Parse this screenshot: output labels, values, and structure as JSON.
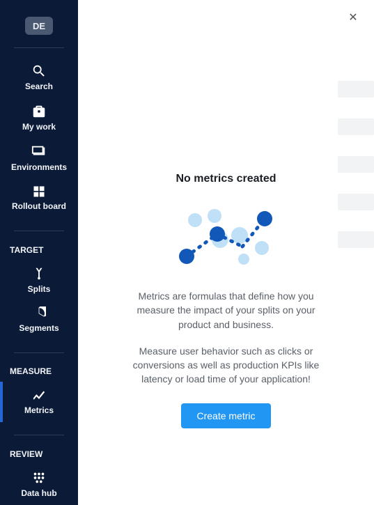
{
  "avatar": {
    "initials": "DE"
  },
  "sidebar": {
    "items": [
      {
        "label": "Search"
      },
      {
        "label": "My work"
      },
      {
        "label": "Environments"
      },
      {
        "label": "Rollout board"
      }
    ],
    "sections": {
      "target": {
        "title": "TARGET",
        "items": [
          {
            "label": "Splits"
          },
          {
            "label": "Segments"
          }
        ]
      },
      "measure": {
        "title": "MEASURE",
        "items": [
          {
            "label": "Metrics"
          }
        ]
      },
      "review": {
        "title": "REVIEW",
        "items": [
          {
            "label": "Data hub"
          }
        ]
      }
    }
  },
  "empty": {
    "title": "No metrics created",
    "p1": "Metrics are formulas that define how you measure the impact of your splits on your product and business.",
    "p2": "Measure user behavior such as clicks or conversions as well as production KPIs like latency or load time of your application!",
    "button": "Create metric"
  }
}
